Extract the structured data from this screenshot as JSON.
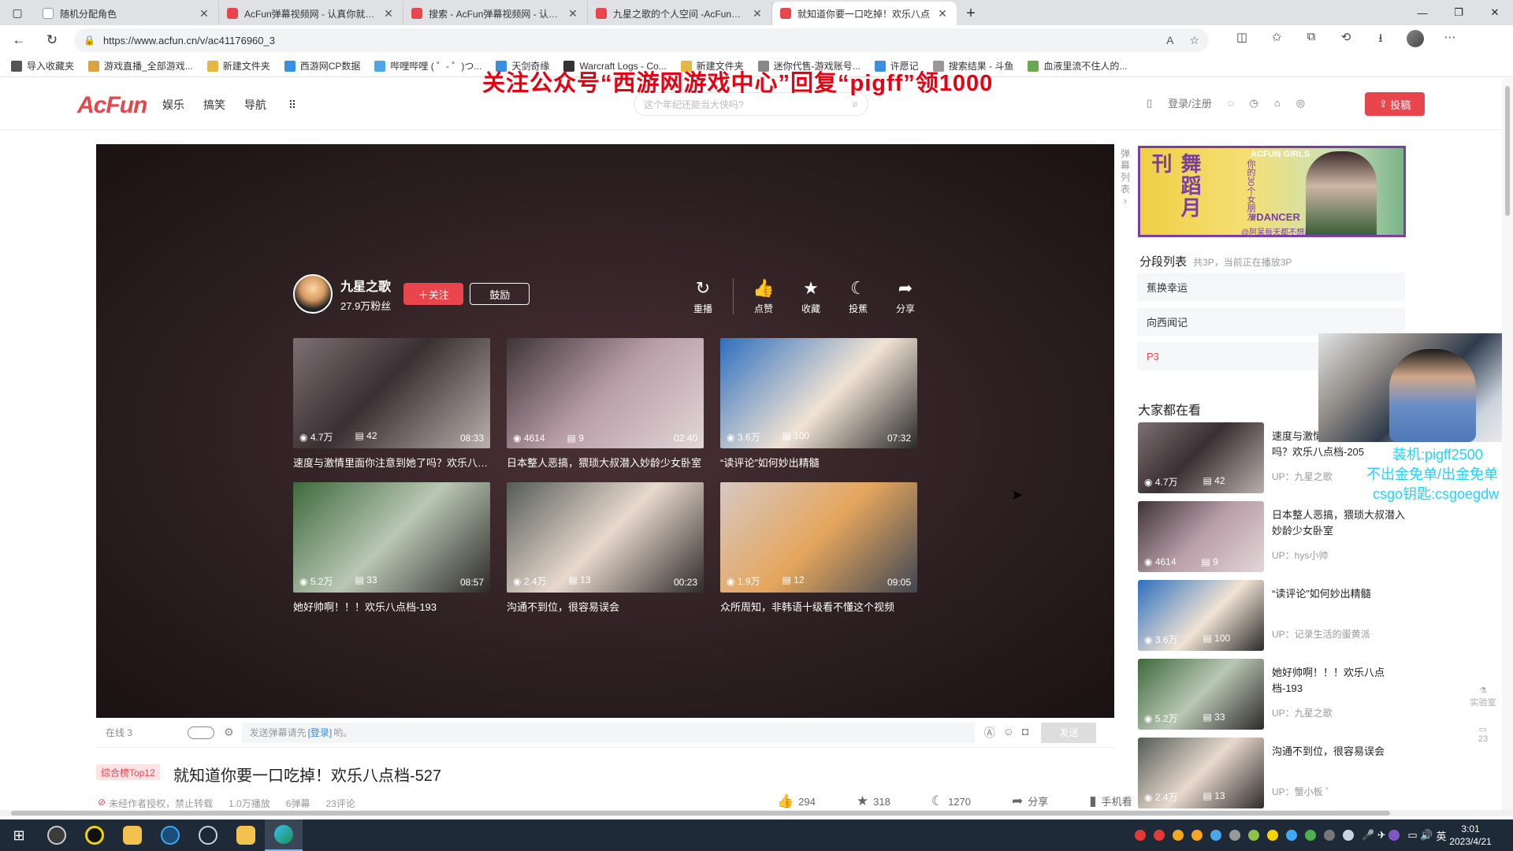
{
  "browser": {
    "tabs": [
      {
        "title": "随机分配角色",
        "favicon_color": "#ffffff",
        "active": false
      },
      {
        "title": "AcFun弹幕视频网 - 认真你就输啦",
        "favicon_color": "#e8454c",
        "active": false
      },
      {
        "title": "搜索 - AcFun弹幕视频网 - 认真你",
        "favicon_color": "#e8454c",
        "active": false
      },
      {
        "title": "九星之歌的个人空间 -AcFun弹幕",
        "favicon_color": "#e8454c",
        "active": false
      },
      {
        "title": "就知道你要一口吃掉！欢乐八点",
        "favicon_color": "#e8454c",
        "active": true
      }
    ],
    "url": "https://www.acfun.cn/v/ac41176960_3",
    "bookmarks": [
      {
        "label": "导入收藏夹",
        "color": "#555555"
      },
      {
        "label": "游戏直播_全部游戏...",
        "color": "#d9a441"
      },
      {
        "label": "新建文件夹",
        "color": "#e5b742"
      },
      {
        "label": "西游网CP数据",
        "color": "#3b8fe0"
      },
      {
        "label": "哔哩哔哩 ( ゜- ゜)つ...",
        "color": "#4aa8e8"
      },
      {
        "label": "天剑奇缘",
        "color": "#3b8fe0"
      },
      {
        "label": "Warcraft Logs - Co...",
        "color": "#333333"
      },
      {
        "label": "新建文件夹",
        "color": "#e5b742"
      },
      {
        "label": "迷你代售-游戏账号...",
        "color": "#888888"
      },
      {
        "label": "许愿记",
        "color": "#3b8fe0"
      },
      {
        "label": "搜索结果 - 斗鱼",
        "color": "#999999"
      },
      {
        "label": "血液里流不住人的...",
        "color": "#6aa84f"
      }
    ]
  },
  "promo_overlay": "关注公众号“西游网游戏中心”回复“pigff”领1000",
  "site": {
    "logo": "AcFun",
    "nav": [
      "娱乐",
      "搞笑",
      "导航"
    ],
    "search_placeholder": "这个年纪还能当大侠吗?",
    "login": "登录/注册",
    "upload_label": "投稿"
  },
  "player": {
    "uploader": {
      "name": "九星之歌",
      "fans": "27.9万粉丝"
    },
    "follow_label": "＋关注",
    "cheer_label": "鼓励",
    "actions": [
      "重播",
      "点赞",
      "收藏",
      "投蕉",
      "分享"
    ],
    "recommendations": [
      {
        "views": "4.7万",
        "comments": "42",
        "duration": "08:33",
        "title": "速度与激情里面你注意到她了吗？欢乐八点档-205"
      },
      {
        "views": "4614",
        "comments": "9",
        "duration": "02:40",
        "title": "日本整人恶搞，猥琐大叔潜入妙龄少女卧室"
      },
      {
        "views": "3.6万",
        "comments": "100",
        "duration": "07:32",
        "title": "“读评论”如何妙出精髓"
      },
      {
        "views": "5.2万",
        "comments": "33",
        "duration": "08:57",
        "title": "她好帅啊！！！欢乐八点档-193"
      },
      {
        "views": "2.4万",
        "comments": "13",
        "duration": "00:23",
        "title": "沟通不到位，很容易误会"
      },
      {
        "views": "1.9万",
        "comments": "12",
        "duration": "09:05",
        "title": "众所周知，非韩语十级看不懂这个视频"
      }
    ]
  },
  "danmaku": {
    "online": "在线  3",
    "input_prefix": "发送弹幕请先",
    "input_link": "[登录]",
    "input_suffix": "哟。",
    "send_label": "发送"
  },
  "video": {
    "rank_badge": "综合榜Top12",
    "title": "就知道你要一口吃掉！欢乐八点档-527",
    "meta": [
      "未经作者授权，禁止转载",
      "1.0万播放",
      "6弹幕",
      "23评论"
    ],
    "actions": [
      {
        "icon": "thumb-up-icon",
        "value": "294"
      },
      {
        "icon": "star-icon",
        "value": "318"
      },
      {
        "icon": "banana-icon",
        "value": "1270"
      },
      {
        "icon": "share-icon",
        "value": "分享"
      },
      {
        "icon": "phone-icon",
        "value": "手机看"
      }
    ]
  },
  "sidebar": {
    "danmu_list_tab": "弹幕列表",
    "banner": {
      "vertical": "舞蹈月刊",
      "side": "你的30个女朋友",
      "tag": "#DANCER",
      "footer": "@阿呆每天都不想动",
      "corner": "ACFUN GIRLS"
    },
    "parts_title": "分段列表",
    "parts_sub": "共3P，当前正在播放3P",
    "parts": [
      "蕉换幸运",
      "向西闻记",
      "P3"
    ],
    "everyone_title": "大家都在看",
    "related": [
      {
        "title": "速度与激情里面你注意到她了吗？欢乐八点档-205",
        "up": "UP：九星之歌",
        "views": "4.7万",
        "comments": "42"
      },
      {
        "title": "日本整人恶搞，猥琐大叔潜入妙龄少女卧室",
        "up": "UP：hys小帅",
        "views": "4614",
        "comments": "9"
      },
      {
        "title": "“读评论”如何妙出精髓",
        "up": "UP：记录生活的蛋黄派",
        "views": "3.6万",
        "comments": "100"
      },
      {
        "title": "她好帅啊！！！欢乐八点档-193",
        "up": "UP：九星之歌",
        "views": "5.2万",
        "comments": "33"
      },
      {
        "title": "沟通不到位，很容易误会",
        "up": "UP：蟹小板 ゜",
        "views": "2.4万",
        "comments": "13"
      }
    ],
    "float_lab": "实验室",
    "float_count": "23"
  },
  "stream_overlay": [
    "装机:pigff2500",
    "不出金免单/出金免单",
    "csgo钥匙:csgoegdw"
  ],
  "taskbar": {
    "time": "3:01",
    "date": "2023/4/21",
    "ime": "英"
  }
}
